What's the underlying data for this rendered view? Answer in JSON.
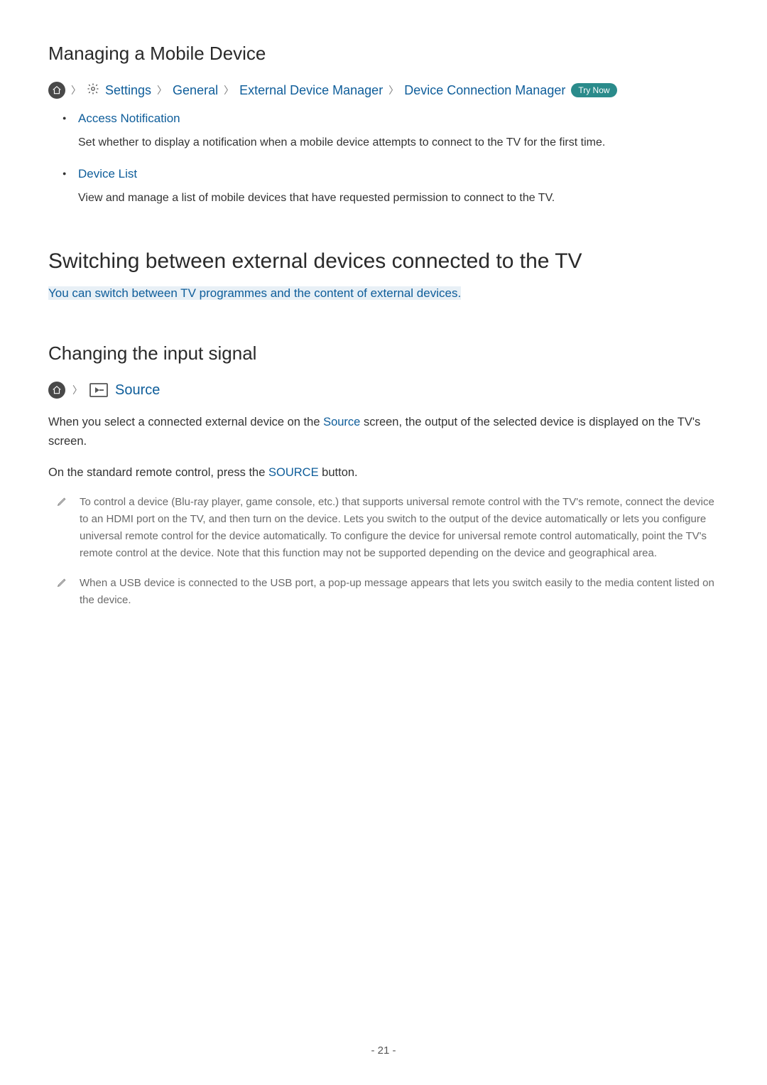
{
  "section1": {
    "heading": "Managing a Mobile Device",
    "breadcrumb": {
      "settings": "Settings",
      "general": "General",
      "edm": "External Device Manager",
      "dcm": "Device Connection Manager",
      "tryNow": "Try Now"
    },
    "items": [
      {
        "title": "Access Notification",
        "desc": "Set whether to display a notification when a mobile device attempts to connect to the TV for the first time."
      },
      {
        "title": "Device List",
        "desc": "View and manage a list of mobile devices that have requested permission to connect to the TV."
      }
    ]
  },
  "section2": {
    "heading": "Switching between external devices connected to the TV",
    "intro": "You can switch between TV programmes and the content of external devices."
  },
  "section3": {
    "heading": "Changing the input signal",
    "sourceLabel": "Source",
    "para1_a": "When you select a connected external device on the ",
    "para1_link": "Source",
    "para1_b": " screen, the output of the selected device is displayed on the TV's screen.",
    "para2_a": "On the standard remote control, press the ",
    "para2_link": "SOURCE",
    "para2_b": " button.",
    "notes": [
      "To control a device (Blu-ray player, game console, etc.) that supports universal remote control with the TV's remote, connect the device to an HDMI port on the TV, and then turn on the device. Lets you switch to the output of the device automatically or lets you configure universal remote control for the device automatically. To configure the device for universal remote control automatically, point the TV's remote control at the device. Note that this function may not be supported depending on the device and geographical area.",
      "When a USB device is connected to the USB port, a pop-up message appears that lets you switch easily to the media content listed on the device."
    ]
  },
  "pageNumber": "- 21 -"
}
